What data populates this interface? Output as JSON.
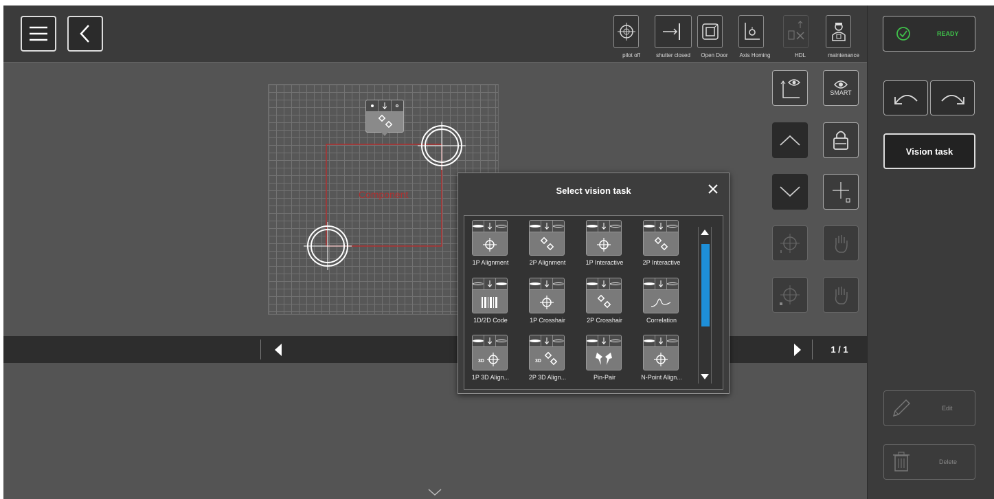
{
  "toolbar": {
    "items": [
      {
        "label": "pilot off",
        "icon": "crosshair-icon"
      },
      {
        "label": "shutter closed",
        "icon": "shutter-icon"
      },
      {
        "label": "Open Door",
        "icon": "door-icon"
      },
      {
        "label": "Axis Homing",
        "icon": "axis-homing-icon"
      },
      {
        "label": "HDL",
        "icon": "hdl-icon"
      },
      {
        "label": "maintenance",
        "icon": "maintenance-icon"
      }
    ]
  },
  "status": {
    "label": "READY",
    "color": "#3fc04a"
  },
  "right_panel": {
    "vision_task_label": "Vision task",
    "edit_label": "Edit",
    "delete_label": "Delete"
  },
  "canvas": {
    "component_label": "Component",
    "smart_label": "SMART"
  },
  "pager": {
    "page": "1 / 1"
  },
  "modal": {
    "title": "Select vision task",
    "tiles": [
      {
        "label": "1P Alignment",
        "icon": "crosshair-icon"
      },
      {
        "label": "2P Alignment",
        "icon": "two-point-icon"
      },
      {
        "label": "1P Interactive",
        "icon": "crosshair-icon"
      },
      {
        "label": "2P Interactive",
        "icon": "two-point-icon"
      },
      {
        "label": "1D/2D Code",
        "icon": "barcode-icon"
      },
      {
        "label": "1P Crosshair",
        "icon": "crosshair-icon"
      },
      {
        "label": "2P Crosshair",
        "icon": "two-point-icon"
      },
      {
        "label": "Correlation",
        "icon": "correlation-icon"
      },
      {
        "label": "1P 3D Align...",
        "icon": "crosshair-3d-icon"
      },
      {
        "label": "2P 3D Align...",
        "icon": "two-point-3d-icon"
      },
      {
        "label": "Pin-Pair",
        "icon": "pin-pair-icon"
      },
      {
        "label": "N-Point Align...",
        "icon": "crosshair-icon"
      }
    ]
  },
  "colors": {
    "accent": "#1e8fd8",
    "component_outline": "#b03030",
    "ready": "#3fc04a"
  }
}
